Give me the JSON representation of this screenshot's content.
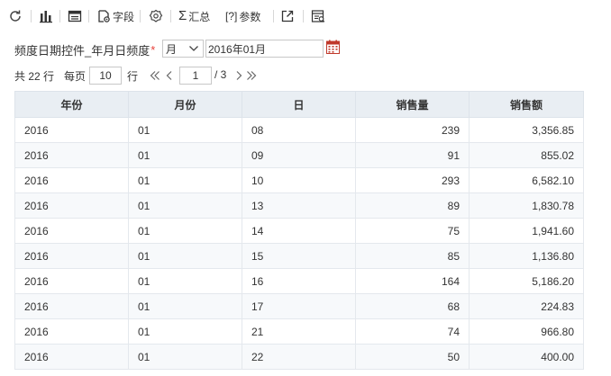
{
  "toolbar": {
    "refresh_icon": "refresh-icon",
    "chart_icon": "bar-chart-icon",
    "table_icon": "table-icon",
    "fields_label": "字段",
    "settings_icon": "gear-icon",
    "summary_label": "汇总",
    "params_label": "参数",
    "params_prefix": "[?]",
    "export_icon": "external-link-icon",
    "view_icon": "view-icon"
  },
  "filter": {
    "label": "频度日期控件_年月日频度",
    "required_mark": "*",
    "frequency_value": "月",
    "date_value": "2016年01月"
  },
  "pager": {
    "total_text": "共 22 行",
    "per_page_label": "每页",
    "per_page_value": "10",
    "rows_unit": "行",
    "current_page": "1",
    "total_pages_text": "/ 3"
  },
  "table": {
    "columns": [
      "年份",
      "月份",
      "日",
      "销售量",
      "销售额"
    ],
    "rows": [
      [
        "2016",
        "01",
        "08",
        "239",
        "3,356.85"
      ],
      [
        "2016",
        "01",
        "09",
        "91",
        "855.02"
      ],
      [
        "2016",
        "01",
        "10",
        "293",
        "6,582.10"
      ],
      [
        "2016",
        "01",
        "13",
        "89",
        "1,830.78"
      ],
      [
        "2016",
        "01",
        "14",
        "75",
        "1,941.60"
      ],
      [
        "2016",
        "01",
        "15",
        "85",
        "1,136.80"
      ],
      [
        "2016",
        "01",
        "16",
        "164",
        "5,186.20"
      ],
      [
        "2016",
        "01",
        "17",
        "68",
        "224.83"
      ],
      [
        "2016",
        "01",
        "21",
        "74",
        "966.80"
      ],
      [
        "2016",
        "01",
        "22",
        "50",
        "400.00"
      ]
    ]
  },
  "colors": {
    "header_bg": "#e9eef3",
    "alt_row_bg": "#f7f9fb",
    "required": "#e8403a",
    "calendar": "#c0392b"
  }
}
